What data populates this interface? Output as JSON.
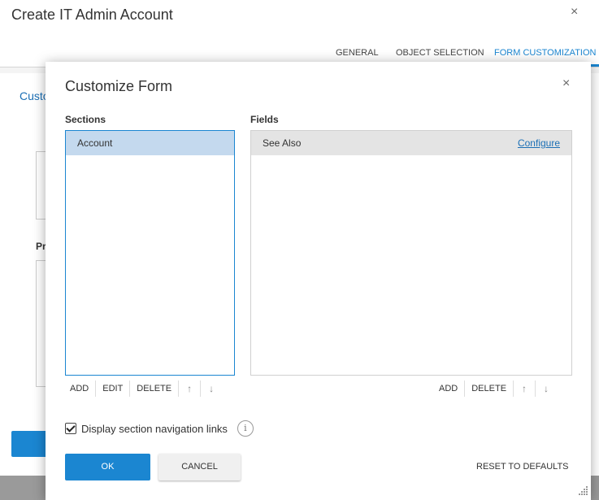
{
  "background": {
    "title": "Create IT Admin Account",
    "close_icon": "×",
    "tabs": [
      {
        "label": "GENERAL"
      },
      {
        "label": "OBJECT SELECTION"
      },
      {
        "label": "FORM CUSTOMIZATION"
      }
    ],
    "section_label": "Customize",
    "pr_label": "Pr"
  },
  "modal": {
    "title": "Customize Form",
    "close_icon": "×",
    "sections_label": "Sections",
    "fields_label": "Fields",
    "sections": [
      {
        "label": "Account"
      }
    ],
    "fields": [
      {
        "label": "See Also",
        "action": "Configure"
      }
    ],
    "sections_toolbar": {
      "add": "ADD",
      "edit": "EDIT",
      "delete": "DELETE",
      "up": "↑",
      "down": "↓"
    },
    "fields_toolbar": {
      "add": "ADD",
      "delete": "DELETE",
      "up": "↑",
      "down": "↓"
    },
    "nav_links_label": "Display section navigation links",
    "nav_links_checked": true,
    "info_icon": "i",
    "ok_label": "OK",
    "cancel_label": "CANCEL",
    "reset_label": "RESET TO DEFAULTS"
  },
  "colors": {
    "accent": "#1b86d1",
    "selected_row": "#c4d9ee"
  }
}
